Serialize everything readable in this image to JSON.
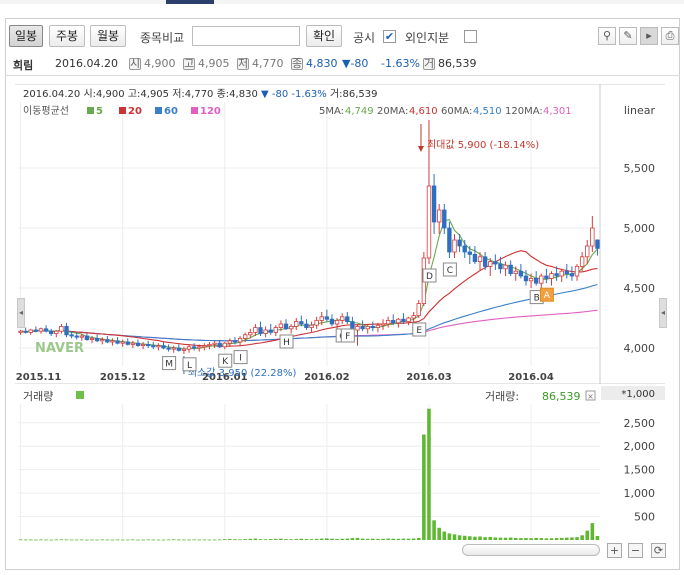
{
  "toolbar": {
    "daily": "일봉",
    "weekly": "주봉",
    "monthly": "월봉",
    "compare_label": "종목비교",
    "confirm": "확인",
    "disclosure_label": "공시",
    "foreign_label": "외인지분",
    "disclosure_checked": true,
    "foreign_checked": false
  },
  "info": {
    "name": "희림",
    "date": "2016.04.20",
    "open_icon": "시",
    "open": "4,900",
    "high_icon": "고",
    "high": "4,905",
    "low_icon": "저",
    "low": "4,770",
    "close_icon": "종",
    "close": "4,830",
    "change": "▼-80",
    "change_pct": "-1.63%",
    "vol_icon": "거",
    "volume": "86,539"
  },
  "chart_data": {
    "type": "candlestick",
    "header": {
      "date": "2016.04.20",
      "open_label": "시:",
      "open": "4,900",
      "high_label": "고:",
      "high": "4,905",
      "low_label": "저:",
      "low": "4,770",
      "close_label": "종:",
      "close": "4,830",
      "arrow": "▼",
      "change": "-80",
      "pct": "-1.63%",
      "vol_label": "거:",
      "volume": "86,539"
    },
    "ma_legend_title": "이동평균선",
    "ma_legend": [
      {
        "label": "5",
        "color": "#6aa84f"
      },
      {
        "label": "20",
        "color": "#cc3333"
      },
      {
        "label": "60",
        "color": "#3a7fc8"
      },
      {
        "label": "120",
        "color": "#e060c0"
      }
    ],
    "ma_values": [
      {
        "label": "5MA:",
        "value": "4,749",
        "color": "#6aa84f"
      },
      {
        "label": "20MA:",
        "value": "4,610",
        "color": "#cc3333"
      },
      {
        "label": "60MA:",
        "value": "4,510",
        "color": "#3a7fc8"
      },
      {
        "label": "120MA:",
        "value": "4,301",
        "color": "#e060c0"
      }
    ],
    "scale_label": "linear",
    "max_label": "최대값 5,900 (-18.14%)",
    "min_label": "최소값 3,950 (22.28%)",
    "price_ticks": [
      "5,500",
      "5,000",
      "4,500",
      "4,000"
    ],
    "price_tick_values": [
      5500,
      5000,
      4500,
      4000
    ],
    "ylim": [
      3850,
      6050
    ],
    "x_ticks": [
      "2015.11",
      "2015.12",
      "2016.01",
      "2016.02",
      "2016.03",
      "2016.04"
    ],
    "x_tick_idx": [
      0,
      20,
      40,
      60,
      80,
      100
    ],
    "watermark": "NAVER",
    "event_markers": [
      {
        "label": "M",
        "idx": 29
      },
      {
        "label": "L",
        "idx": 33
      },
      {
        "label": "K",
        "idx": 40
      },
      {
        "label": "I",
        "idx": 43
      },
      {
        "label": "H",
        "idx": 52
      },
      {
        "label": "G",
        "idx": 63
      },
      {
        "label": "F",
        "idx": 64
      },
      {
        "label": "E",
        "idx": 78
      },
      {
        "label": "D",
        "idx": 80
      },
      {
        "label": "C",
        "idx": 84
      },
      {
        "label": "B",
        "idx": 101
      },
      {
        "label": "A",
        "idx": 103
      }
    ],
    "volume_label": "거래량",
    "volume_header_label": "거래량:",
    "volume_header_value": "86,539",
    "volume_scale": "*1,000",
    "volume_ticks": [
      "2,500",
      "2,000",
      "1,500",
      "1,000",
      "500"
    ],
    "volume_tick_values": [
      2500,
      2000,
      1500,
      1000,
      500
    ],
    "volume_ylim": [
      0,
      2900
    ],
    "candles": [
      [
        4130,
        4150,
        4110,
        4140
      ],
      [
        4140,
        4170,
        4120,
        4130
      ],
      [
        4130,
        4160,
        4110,
        4150
      ],
      [
        4150,
        4180,
        4130,
        4140
      ],
      [
        4140,
        4170,
        4120,
        4160
      ],
      [
        4160,
        4190,
        4130,
        4140
      ],
      [
        4140,
        4160,
        4100,
        4120
      ],
      [
        4120,
        4150,
        4090,
        4140
      ],
      [
        4140,
        4200,
        4120,
        4180
      ],
      [
        4180,
        4210,
        4090,
        4110
      ],
      [
        4110,
        4140,
        4080,
        4100
      ],
      [
        4100,
        4130,
        4070,
        4090
      ],
      [
        4090,
        4120,
        4060,
        4100
      ],
      [
        4100,
        4120,
        4060,
        4070
      ],
      [
        4070,
        4100,
        4040,
        4080
      ],
      [
        4080,
        4110,
        4050,
        4060
      ],
      [
        4060,
        4090,
        4030,
        4070
      ],
      [
        4070,
        4100,
        4040,
        4050
      ],
      [
        4050,
        4080,
        4020,
        4060
      ],
      [
        4060,
        4090,
        4030,
        4040
      ],
      [
        4040,
        4070,
        4010,
        4050
      ],
      [
        4050,
        4080,
        4020,
        4030
      ],
      [
        4030,
        4060,
        4000,
        4040
      ],
      [
        4040,
        4070,
        4010,
        4020
      ],
      [
        4020,
        4050,
        3990,
        4030
      ],
      [
        4030,
        4060,
        4000,
        4020
      ],
      [
        4020,
        4050,
        3990,
        4010
      ],
      [
        4010,
        4040,
        3980,
        4020
      ],
      [
        4020,
        4050,
        3990,
        4000
      ],
      [
        4000,
        4030,
        3970,
        3990
      ],
      [
        3990,
        4020,
        3960,
        4000
      ],
      [
        4000,
        4030,
        3970,
        3980
      ],
      [
        3980,
        4010,
        3950,
        3990
      ],
      [
        3990,
        4030,
        3960,
        4010
      ],
      [
        4010,
        4040,
        3980,
        4000
      ],
      [
        4000,
        4030,
        3970,
        4010
      ],
      [
        4010,
        4040,
        3980,
        4020
      ],
      [
        4020,
        4050,
        3990,
        4030
      ],
      [
        4030,
        4060,
        4000,
        4040
      ],
      [
        4040,
        4060,
        4000,
        4010
      ],
      [
        4010,
        4050,
        3990,
        4040
      ],
      [
        4040,
        4080,
        4010,
        4060
      ],
      [
        4060,
        4090,
        4030,
        4050
      ],
      [
        4050,
        4100,
        4020,
        4080
      ],
      [
        4080,
        4130,
        4050,
        4110
      ],
      [
        4110,
        4160,
        4080,
        4130
      ],
      [
        4130,
        4200,
        4100,
        4170
      ],
      [
        4170,
        4220,
        4100,
        4120
      ],
      [
        4120,
        4180,
        4090,
        4150
      ],
      [
        4150,
        4200,
        4110,
        4130
      ],
      [
        4130,
        4190,
        4100,
        4170
      ],
      [
        4170,
        4230,
        4140,
        4200
      ],
      [
        4200,
        4240,
        4150,
        4160
      ],
      [
        4160,
        4200,
        4120,
        4180
      ],
      [
        4180,
        4250,
        4150,
        4220
      ],
      [
        4220,
        4270,
        4180,
        4200
      ],
      [
        4200,
        4240,
        4150,
        4170
      ],
      [
        4170,
        4220,
        4130,
        4190
      ],
      [
        4190,
        4260,
        4160,
        4230
      ],
      [
        4230,
        4300,
        4190,
        4260
      ],
      [
        4260,
        4320,
        4220,
        4240
      ],
      [
        4240,
        4280,
        4180,
        4200
      ],
      [
        4200,
        4250,
        4160,
        4230
      ],
      [
        4230,
        4290,
        4200,
        4260
      ],
      [
        4260,
        4300,
        4200,
        4220
      ],
      [
        4220,
        4260,
        4100,
        4150
      ],
      [
        4150,
        4200,
        4020,
        4180
      ],
      [
        4180,
        4230,
        4140,
        4160
      ],
      [
        4160,
        4200,
        4120,
        4180
      ],
      [
        4180,
        4220,
        4140,
        4170
      ],
      [
        4170,
        4210,
        4130,
        4190
      ],
      [
        4190,
        4240,
        4150,
        4200
      ],
      [
        4200,
        4260,
        4170,
        4230
      ],
      [
        4230,
        4280,
        4190,
        4210
      ],
      [
        4210,
        4250,
        4170,
        4240
      ],
      [
        4240,
        4290,
        4200,
        4220
      ],
      [
        4220,
        4260,
        4190,
        4250
      ],
      [
        4250,
        4300,
        4210,
        4270
      ],
      [
        4270,
        4400,
        4250,
        4370
      ],
      [
        4370,
        4800,
        4350,
        4750
      ],
      [
        4750,
        5900,
        4700,
        5350
      ],
      [
        5350,
        5450,
        4950,
        5050
      ],
      [
        5050,
        5200,
        4950,
        5150
      ],
      [
        5150,
        5200,
        4950,
        5000
      ],
      [
        5000,
        5050,
        4750,
        4800
      ],
      [
        4800,
        4950,
        4750,
        4900
      ],
      [
        4900,
        4950,
        4800,
        4850
      ],
      [
        4850,
        4900,
        4750,
        4800
      ],
      [
        4800,
        4850,
        4700,
        4780
      ],
      [
        4780,
        4850,
        4700,
        4720
      ],
      [
        4720,
        4800,
        4650,
        4760
      ],
      [
        4760,
        4800,
        4650,
        4680
      ],
      [
        4680,
        4750,
        4600,
        4720
      ],
      [
        4720,
        4780,
        4650,
        4700
      ],
      [
        4700,
        4760,
        4620,
        4660
      ],
      [
        4660,
        4720,
        4600,
        4690
      ],
      [
        4690,
        4730,
        4600,
        4620
      ],
      [
        4620,
        4680,
        4560,
        4640
      ],
      [
        4640,
        4700,
        4580,
        4600
      ],
      [
        4600,
        4650,
        4520,
        4560
      ],
      [
        4560,
        4620,
        4500,
        4580
      ],
      [
        4580,
        4640,
        4520,
        4540
      ],
      [
        4540,
        4620,
        4480,
        4600
      ],
      [
        4600,
        4660,
        4540,
        4580
      ],
      [
        4580,
        4640,
        4520,
        4620
      ],
      [
        4620,
        4680,
        4560,
        4600
      ],
      [
        4600,
        4660,
        4550,
        4640
      ],
      [
        4640,
        4700,
        4580,
        4620
      ],
      [
        4620,
        4680,
        4560,
        4600
      ],
      [
        4600,
        4700,
        4560,
        4680
      ],
      [
        4680,
        4800,
        4640,
        4760
      ],
      [
        4760,
        4900,
        4700,
        4850
      ],
      [
        4850,
        5100,
        4800,
        5000
      ],
      [
        4900,
        4905,
        4770,
        4830
      ]
    ],
    "volumes": [
      12,
      10,
      11,
      9,
      13,
      10,
      8,
      11,
      14,
      12,
      10,
      9,
      11,
      8,
      10,
      9,
      12,
      10,
      8,
      11,
      9,
      10,
      12,
      8,
      9,
      11,
      10,
      9,
      8,
      12,
      15,
      11,
      10,
      9,
      12,
      10,
      11,
      9,
      10,
      12,
      18,
      22,
      16,
      14,
      20,
      25,
      30,
      18,
      15,
      20,
      24,
      28,
      19,
      16,
      22,
      26,
      20,
      18,
      24,
      30,
      35,
      28,
      22,
      26,
      30,
      40,
      45,
      30,
      25,
      28,
      24,
      26,
      30,
      28,
      25,
      30,
      28,
      32,
      45,
      2250,
      2800,
      420,
      260,
      180,
      140,
      120,
      100,
      90,
      80,
      70,
      75,
      60,
      65,
      55,
      50,
      48,
      52,
      45,
      40,
      42,
      38,
      44,
      40,
      36,
      38,
      42,
      45,
      50,
      55,
      60,
      100,
      200,
      360,
      86
    ]
  }
}
